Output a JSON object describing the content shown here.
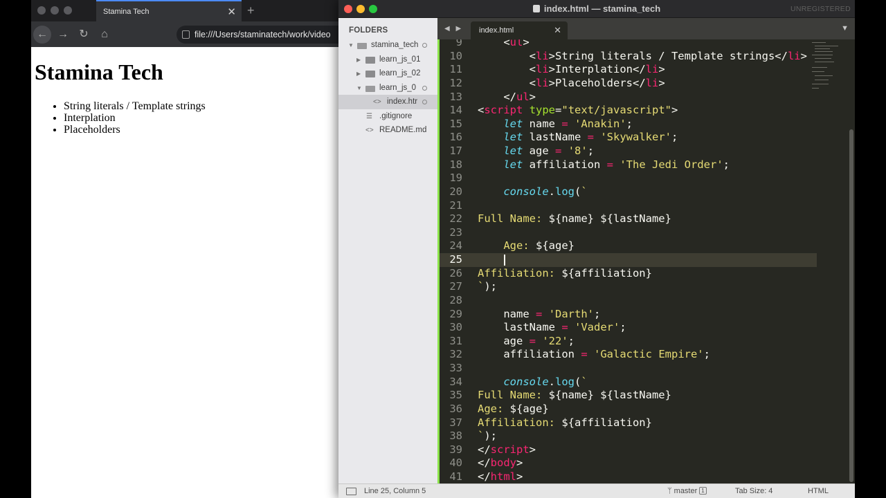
{
  "browser": {
    "tab_title": "Stamina Tech",
    "tab_close": "✕",
    "new_tab": "+",
    "url": "file:///Users/staminatech/work/video",
    "back_icon": "←",
    "forward_icon": "→",
    "reload_icon": "↻",
    "home_icon": "⌂",
    "page": {
      "heading": "Stamina Tech",
      "items": [
        "String literals / Template strings",
        "Interplation",
        "Placeholders"
      ]
    }
  },
  "sublime": {
    "title": "index.html — stamina_tech",
    "unregistered": "UNREGISTERED",
    "sidebar": {
      "header": "FOLDERS",
      "items": [
        {
          "label": "stamina_tech",
          "arrow": "▼"
        },
        {
          "label": "learn_js_01",
          "arrow": "▶"
        },
        {
          "label": "learn_js_02",
          "arrow": "▶"
        },
        {
          "label": "learn_js_0",
          "arrow": "▼"
        },
        {
          "label": "index.htr",
          "glyph": "<>"
        },
        {
          "label": ".gitignore",
          "glyph": "☰"
        },
        {
          "label": "README.md",
          "glyph": "<>"
        }
      ]
    },
    "tab_nav": "◀ ▶",
    "tab": {
      "label": "index.html",
      "close": "✕"
    },
    "tab_menu": "▼",
    "editor": {
      "active_line": 25,
      "line_numbers": [
        "9",
        "10",
        "11",
        "12",
        "13",
        "14",
        "15",
        "16",
        "17",
        "18",
        "19",
        "20",
        "21",
        "22",
        "23",
        "24",
        "25",
        "26",
        "27",
        "28",
        "29",
        "30",
        "31",
        "32",
        "33",
        "34",
        "35",
        "36",
        "37",
        "38",
        "39",
        "40",
        "41"
      ]
    },
    "status": {
      "position": "Line 25, Column 5",
      "branch": "master",
      "branch_count": "1",
      "tab_size": "Tab Size: 4",
      "syntax": "HTML"
    }
  },
  "colors": {
    "editor_bg": "#272822",
    "tag": "#f92672",
    "attr": "#a6e22e",
    "string": "#e6db74",
    "keyword": "#66d9ef",
    "focus_border": "#8ce34a"
  }
}
